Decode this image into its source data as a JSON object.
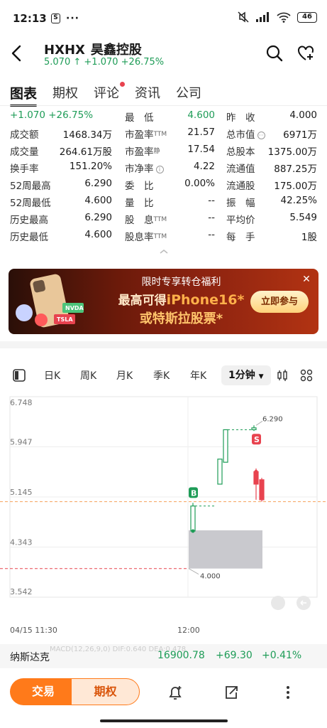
{
  "status_bar": {
    "time": "12:13",
    "left_badge": "S",
    "dots": "···",
    "battery": "46"
  },
  "header": {
    "ticker": "HXHX",
    "name": "昊鑫控股",
    "price": "5.070",
    "arrow": "↑",
    "change": "+1.070",
    "change_pct": "+26.75%"
  },
  "tabs": [
    {
      "label": "图表",
      "active": true
    },
    {
      "label": "期权"
    },
    {
      "label": "评论",
      "dot": true
    },
    {
      "label": "资讯"
    },
    {
      "label": "公司"
    }
  ],
  "stats": [
    {
      "l1": "",
      "v1": "",
      "l2": "最　低",
      "v2": "4.600",
      "l3": "昨　收",
      "v3": "4.000"
    },
    {
      "l1": "成交额",
      "v1": "1468.34万",
      "l2": "市盈率",
      "l2sup": "TTM",
      "v2": "21.57",
      "l3": "总市值",
      "v3": "6971万"
    },
    {
      "l1": "成交量",
      "v1": "264.61万股",
      "l2": "市盈率",
      "l2sup": "静",
      "v2": "17.54",
      "l3": "总股本",
      "v3": "1375.00万"
    },
    {
      "l1": "换手率",
      "v1": "151.20%",
      "l2": "市净率",
      "v2": "4.22",
      "l3": "流通值",
      "v3": "887.25万"
    },
    {
      "l1": "52周最高",
      "v1": "6.290",
      "l2": "委　比",
      "v2": "0.00%",
      "l3": "流通股",
      "v3": "175.00万"
    },
    {
      "l1": "52周最低",
      "v1": "4.600",
      "l2": "量　比",
      "v2": "--",
      "l3": "振　幅",
      "v3": "42.25%"
    },
    {
      "l1": "历史最高",
      "v1": "6.290",
      "l2": "股　息",
      "l2sup": "TTM",
      "v2": "--",
      "l3": "平均价",
      "v3": "5.549"
    },
    {
      "l1": "历史最低",
      "v1": "4.600",
      "l2": "股息率",
      "l2sup": "TTM",
      "v2": "--",
      "l3": "每　手",
      "v3": "1股"
    }
  ],
  "stats_first_row_quote": "+1.070 +26.75%",
  "banner": {
    "line1": "限时专享转仓福利",
    "line2_prefix": "最高可得",
    "line2_highlight": "iPhone16*",
    "line3": "或特斯拉股票*",
    "button": "立即参与",
    "art_tags": [
      "NVDA",
      "TSLA"
    ]
  },
  "chart_toolbar": {
    "items": [
      "日K",
      "周K",
      "月K",
      "季K",
      "年K"
    ],
    "active": "1分钟"
  },
  "chart_data": {
    "type": "candlestick",
    "y_ticks": [
      "6.748",
      "5.947",
      "5.145",
      "4.343",
      "3.542"
    ],
    "ylim": [
      3.542,
      6.748
    ],
    "x_labels": [
      "04/15 11:30",
      "12:00"
    ],
    "prev_close": 4.0,
    "prev_close_label": "4.000",
    "current_price": 5.07,
    "high_label": "6.290",
    "buy_marker": "B",
    "sell_marker": "S",
    "candles": [
      {
        "o": 4.6,
        "c": 5.0,
        "h": 5.05,
        "l": 4.6,
        "up": true
      },
      {
        "o": 5.35,
        "c": 5.75,
        "h": 5.75,
        "l": 5.35,
        "up": true
      },
      {
        "o": 5.7,
        "c": 6.22,
        "h": 6.22,
        "l": 5.7,
        "up": true
      },
      {
        "o": 6.22,
        "c": 6.25,
        "h": 6.29,
        "l": 6.2,
        "up": true
      },
      {
        "o": 5.55,
        "c": 5.35,
        "h": 5.6,
        "l": 5.1,
        "up": false
      },
      {
        "o": 5.42,
        "c": 5.1,
        "h": 5.45,
        "l": 5.07,
        "up": false
      }
    ],
    "gap_zone": {
      "from": 4.0,
      "to": 4.6
    }
  },
  "index_bar": {
    "name": "纳斯达克",
    "ghost_text": "MACD(12,26,9,0)  DIF:0.640  DEA:0.478",
    "value": "16900.78",
    "change": "+69.30",
    "change_pct": "+0.41%"
  },
  "bottom_bar": {
    "trade": "交易",
    "options": "期权"
  },
  "colors": {
    "up_green": "#1e9c57",
    "down_red": "#e8434f",
    "accent_orange": "#ff7a1a"
  }
}
